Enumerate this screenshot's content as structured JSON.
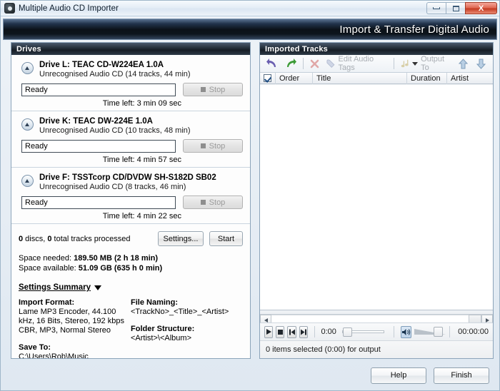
{
  "window": {
    "title": "Multiple Audio CD Importer",
    "banner": "Import & Transfer Digital Audio",
    "minimize": "Minimize",
    "maximize": "Maximize",
    "close": "X"
  },
  "left": {
    "panel_title": "Drives",
    "drives": [
      {
        "name": "Drive L: TEAC CD-W224EA 1.0A",
        "disc": "Unrecognised Audio CD  (14 tracks, 44 min)",
        "status": "Ready",
        "stop_label": "Stop",
        "time_left": "Time left: 3 min 09 sec"
      },
      {
        "name": "Drive K: TEAC DW-224E 1.0A",
        "disc": "Unrecognised Audio CD  (10 tracks, 48 min)",
        "status": "Ready",
        "stop_label": "Stop",
        "time_left": "Time left: 4 min 57 sec"
      },
      {
        "name": "Drive F: TSSTcorp CD/DVDW SH-S182D SB02",
        "disc": "Unrecognised Audio CD  (8 tracks, 46 min)",
        "status": "Ready",
        "stop_label": "Stop",
        "time_left": "Time left: 4 min 22 sec"
      }
    ],
    "processed_discs": "0",
    "processed_discs_label": " discs, ",
    "processed_tracks": "0",
    "processed_tracks_label": " total tracks processed",
    "settings_button": "Settings...",
    "start_button": "Start",
    "space_needed_label": "Space needed: ",
    "space_needed_value": "189.50 MB (2 h 18 min)",
    "space_available_label": "Space available: ",
    "space_available_value": "51.09 GB (635 h 0 min)",
    "summary_title": "Settings Summary",
    "import_format_label": "Import Format:",
    "import_format_value": "Lame MP3 Encoder, 44.100 kHz, 16 Bits, Stereo, 192 kbps CBR, MP3, Normal Stereo",
    "save_to_label": "Save To:",
    "save_to_value": "C:\\Users\\Rob\\Music",
    "file_naming_label": "File Naming:",
    "file_naming_value": "<TrackNo>_<Title>_<Artist>",
    "folder_structure_label": "Folder Structure:",
    "folder_structure_value": "<Artist>\\<Album>"
  },
  "right": {
    "panel_title": "Imported Tracks",
    "toolbar": {
      "undo": "undo-icon",
      "redo": "redo-icon",
      "delete": "delete-icon",
      "edit_tags": "Edit Audio Tags",
      "output_to": "Output To",
      "move_up": "move-up-icon",
      "move_down": "move-down-icon"
    },
    "columns": [
      "Order",
      "Title",
      "Duration",
      "Artist"
    ],
    "player": {
      "play": "play-icon",
      "stop": "stop-icon",
      "previous": "previous-icon",
      "next": "next-icon",
      "elapsed": "0:00",
      "mute": "speaker-icon",
      "total_time": "00:00:00"
    },
    "status": "0 items selected (0:00) for output"
  },
  "footer": {
    "help": "Help",
    "finish": "Finish"
  }
}
